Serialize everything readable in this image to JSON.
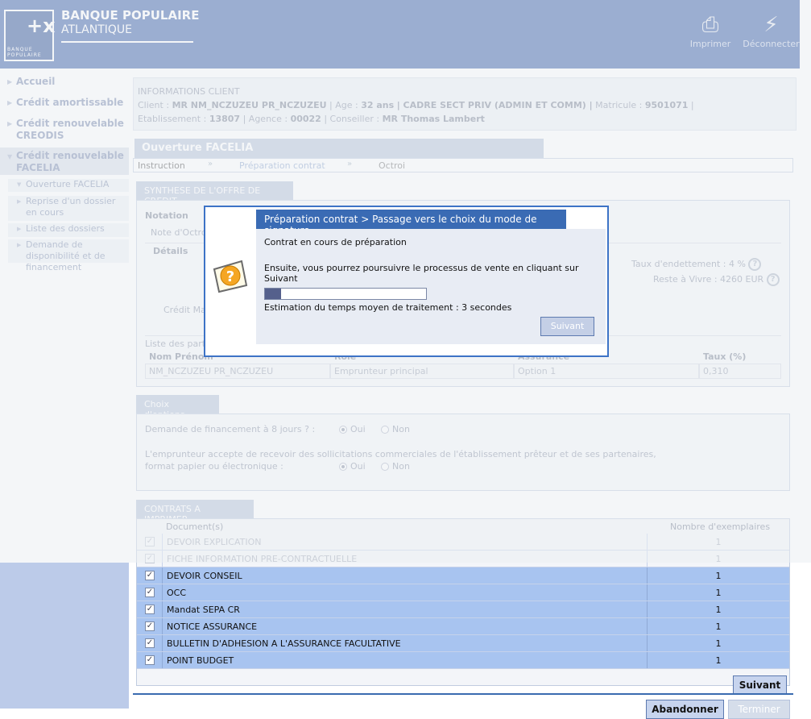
{
  "header": {
    "bank_line1": "BANQUE POPULAIRE",
    "bank_line2": "ATLANTIQUE",
    "logo_small": "BANQUE POPULAIRE",
    "print_label": "Imprimer",
    "logout_label": "Déconnecter"
  },
  "sidebar": {
    "items": [
      {
        "label": "Accueil"
      },
      {
        "label": "Crédit amortissable"
      },
      {
        "label": "Crédit renouvelable CREODIS"
      },
      {
        "label": "Crédit renouvelable FACELIA"
      }
    ],
    "subitems": [
      {
        "label": "Ouverture FACELIA"
      },
      {
        "label": "Reprise d'un dossier en cours"
      },
      {
        "label": "Liste des dossiers"
      },
      {
        "label": "Demande de disponibilité et de financement"
      }
    ]
  },
  "client": {
    "heading": "INFORMATIONS CLIENT",
    "client_label": "Client :",
    "client_name": "MR NM_NCZUZEU PR_NCZUZEU",
    "age_label": "| Age :",
    "age": "32 ans",
    "job": "| CADRE SECT PRIV (ADMIN ET COMM) |",
    "matricule_label": "Matricule :",
    "matricule": "9501071",
    "etab_label": "Etablissement :",
    "etab": "13807",
    "agence_label": "| Agence :",
    "agence": "00022",
    "conseiller_label": "| Conseiller :",
    "conseiller": "MR Thomas Lambert"
  },
  "page": {
    "title": "Ouverture FACELIA",
    "steps": [
      "Instruction",
      "Préparation contrat",
      "Octroi"
    ]
  },
  "synthese": {
    "tab": "SYNTHESE DE L'OFFRE DE CREDIT",
    "notation": "Notation",
    "note_octroi": "Note d'Octro",
    "details": "Détails",
    "taux_endettement": "Taux d'endettement : 4 %",
    "reste_a_vivre": "Reste à Vivre : 4260 EUR",
    "credit_max": "Crédit Max",
    "liste_parties": "Liste des part",
    "columns": [
      "Nom Prénom",
      "Rôle",
      "Assurance",
      "Taux (%)"
    ],
    "row": [
      "NM_NCZUZEU PR_NCZUZEU",
      "Emprunteur principal",
      "Option 1",
      "0,310"
    ]
  },
  "options": {
    "tab": "Choix d'options",
    "q1": "Demande de financement à 8 jours ?",
    "q1_colon": ":",
    "q2_line1": "L'emprunteur accepte de recevoir des sollicitations commerciales de l'établissement prêteur et de ses partenaires,",
    "q2_line2": "format papier ou électronique :",
    "oui": "Oui",
    "non": "Non"
  },
  "contracts": {
    "tab": "CONTRATS A IMPRIMER",
    "col_doc": "Document(s)",
    "col_qty": "Nombre d'exemplaires",
    "rows": [
      {
        "doc": "DEVOIR EXPLICATION",
        "qty": "1"
      },
      {
        "doc": "FICHE INFORMATION PRE-CONTRACTUELLE",
        "qty": "1"
      },
      {
        "doc": "DEVOIR CONSEIL",
        "qty": "1"
      },
      {
        "doc": "OCC",
        "qty": "1"
      },
      {
        "doc": "Mandat SEPA CR",
        "qty": "1"
      },
      {
        "doc": "NOTICE ASSURANCE",
        "qty": "1"
      },
      {
        "doc": "BULLETIN D'ADHESION A L'ASSURANCE FACULTATIVE",
        "qty": "1"
      },
      {
        "doc": "POINT BUDGET",
        "qty": "1"
      }
    ],
    "check_mark": "✓"
  },
  "buttons": {
    "suivant": "Suivant",
    "abandonner": "Abandonner",
    "terminer": "Terminer"
  },
  "modal": {
    "title": "Préparation contrat > Passage vers le choix du mode de signature",
    "line1": "Contrat en cours de préparation",
    "line2": "Ensuite, vous pourrez poursuivre le processus de vente en cliquant sur Suivant",
    "estimate": "Estimation du temps moyen de traitement : 3 secondes",
    "next": "Suivant",
    "progress": 0.1,
    "icon": "question-icon"
  }
}
